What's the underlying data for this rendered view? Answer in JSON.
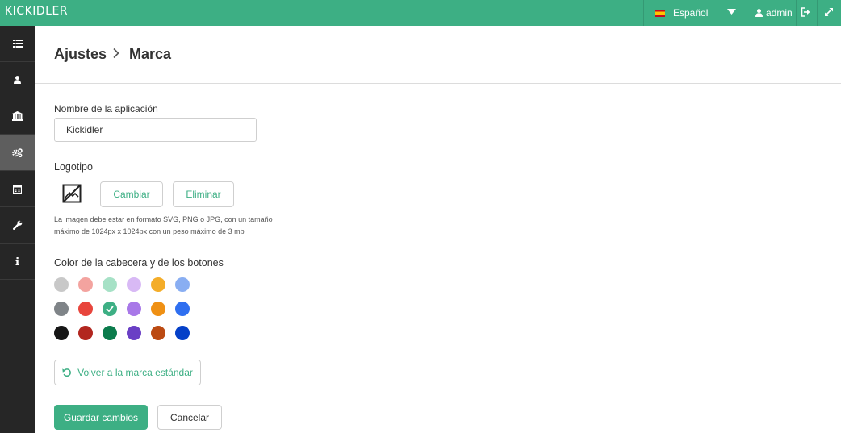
{
  "topbar": {
    "logo": "KICKIDLER",
    "language": "Español",
    "language_flag": "spain-flag",
    "user": "admin"
  },
  "sidebar": {
    "items": [
      {
        "icon": "list-icon",
        "active": false
      },
      {
        "icon": "user-icon",
        "active": false
      },
      {
        "icon": "bank-icon",
        "active": false
      },
      {
        "icon": "gears-icon",
        "active": true
      },
      {
        "icon": "calendar-icon",
        "active": false
      },
      {
        "icon": "wrench-icon",
        "active": false
      },
      {
        "icon": "info-icon",
        "active": false
      }
    ]
  },
  "breadcrumb": {
    "parent": "Ajustes",
    "current": "Marca"
  },
  "form": {
    "app_name_label": "Nombre de la aplicación",
    "app_name_value": "Kickidler",
    "logo_label": "Logotipo",
    "change_label": "Cambiar",
    "remove_label": "Eliminar",
    "hint_line1": "La imagen debe estar en formato SVG, PNG o JPG, con un tamaño",
    "hint_line2": "máximo de 1024px x 1024px con un peso máximo de 3 mb",
    "color_label": "Color de la cabecera y de los botones",
    "reset_label": "Volver a la marca estándar",
    "save_label": "Guardar cambios",
    "cancel_label": "Cancelar"
  },
  "colors": {
    "accent": "#3daf84",
    "selected": "#3daf84",
    "palette": [
      [
        "#c8c8c8",
        "#f3a39f",
        "#a6e1c6",
        "#d8b9f5",
        "#f4ad29",
        "#89aef2"
      ],
      [
        "#7f8488",
        "#e8453c",
        "#3daf84",
        "#a878e8",
        "#ef9014",
        "#2f6ff0"
      ],
      [
        "#161616",
        "#b2261f",
        "#0b7b4c",
        "#6a3fc5",
        "#bb4a12",
        "#0540c8"
      ]
    ]
  }
}
